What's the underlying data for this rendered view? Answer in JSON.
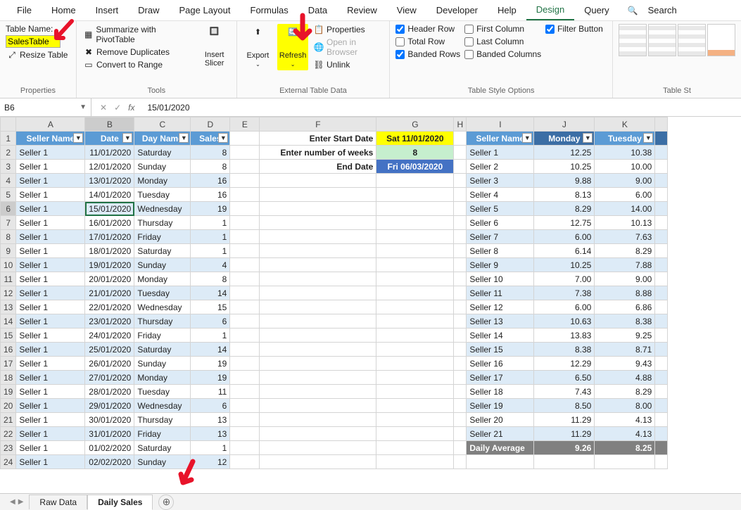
{
  "menu": {
    "items": [
      "File",
      "Home",
      "Insert",
      "Draw",
      "Page Layout",
      "Formulas",
      "Data",
      "Review",
      "View",
      "Developer",
      "Help",
      "Design",
      "Query"
    ],
    "search": "Search"
  },
  "ribbon": {
    "properties": {
      "label": "Properties",
      "table_name_label": "Table Name:",
      "table_name_value": "SalesTable",
      "resize": "Resize Table"
    },
    "tools": {
      "label": "Tools",
      "summarize": "Summarize with PivotTable",
      "remove_dupes": "Remove Duplicates",
      "convert": "Convert to Range",
      "slicer": "Insert\nSlicer"
    },
    "external": {
      "label": "External Table Data",
      "export": "Export",
      "refresh": "Refresh",
      "properties": "Properties",
      "open_browser": "Open in Browser",
      "unlink": "Unlink"
    },
    "style_opts": {
      "label": "Table Style Options",
      "header_row": "Header Row",
      "total_row": "Total Row",
      "banded_rows": "Banded Rows",
      "first_col": "First Column",
      "last_col": "Last Column",
      "banded_cols": "Banded Columns",
      "filter_btn": "Filter Button"
    },
    "table_styles": {
      "label": "Table St"
    }
  },
  "fx": {
    "namebox": "B6",
    "formula": "15/01/2020"
  },
  "cols": [
    "A",
    "B",
    "C",
    "D",
    "E",
    "F",
    "G",
    "H",
    "I",
    "J",
    "K"
  ],
  "left_headers": [
    "Seller Name",
    "Date",
    "Day Name",
    "Sales"
  ],
  "left_rows": [
    [
      "Seller 1",
      "11/01/2020",
      "Saturday",
      "8"
    ],
    [
      "Seller 1",
      "12/01/2020",
      "Sunday",
      "8"
    ],
    [
      "Seller 1",
      "13/01/2020",
      "Monday",
      "16"
    ],
    [
      "Seller 1",
      "14/01/2020",
      "Tuesday",
      "16"
    ],
    [
      "Seller 1",
      "15/01/2020",
      "Wednesday",
      "19"
    ],
    [
      "Seller 1",
      "16/01/2020",
      "Thursday",
      "1"
    ],
    [
      "Seller 1",
      "17/01/2020",
      "Friday",
      "1"
    ],
    [
      "Seller 1",
      "18/01/2020",
      "Saturday",
      "1"
    ],
    [
      "Seller 1",
      "19/01/2020",
      "Sunday",
      "4"
    ],
    [
      "Seller 1",
      "20/01/2020",
      "Monday",
      "8"
    ],
    [
      "Seller 1",
      "21/01/2020",
      "Tuesday",
      "14"
    ],
    [
      "Seller 1",
      "22/01/2020",
      "Wednesday",
      "15"
    ],
    [
      "Seller 1",
      "23/01/2020",
      "Thursday",
      "6"
    ],
    [
      "Seller 1",
      "24/01/2020",
      "Friday",
      "1"
    ],
    [
      "Seller 1",
      "25/01/2020",
      "Saturday",
      "14"
    ],
    [
      "Seller 1",
      "26/01/2020",
      "Sunday",
      "19"
    ],
    [
      "Seller 1",
      "27/01/2020",
      "Monday",
      "19"
    ],
    [
      "Seller 1",
      "28/01/2020",
      "Tuesday",
      "11"
    ],
    [
      "Seller 1",
      "29/01/2020",
      "Wednesday",
      "6"
    ],
    [
      "Seller 1",
      "30/01/2020",
      "Thursday",
      "13"
    ],
    [
      "Seller 1",
      "31/01/2020",
      "Friday",
      "13"
    ],
    [
      "Seller 1",
      "01/02/2020",
      "Saturday",
      "1"
    ],
    [
      "Seller 1",
      "02/02/2020",
      "Sunday",
      "12"
    ]
  ],
  "params": {
    "start_label": "Enter Start Date",
    "start_value": "Sat 11/01/2020",
    "weeks_label": "Enter number of weeks",
    "weeks_value": "8",
    "end_label": "End Date",
    "end_value": "Fri 06/03/2020"
  },
  "right_headers": [
    "Seller Name",
    "Monday",
    "Tuesday"
  ],
  "right_rows": [
    [
      "Seller 1",
      "12.25",
      "10.38"
    ],
    [
      "Seller 2",
      "10.25",
      "10.00"
    ],
    [
      "Seller 3",
      "9.88",
      "9.00"
    ],
    [
      "Seller 4",
      "8.13",
      "6.00"
    ],
    [
      "Seller 5",
      "8.29",
      "14.00"
    ],
    [
      "Seller 6",
      "12.75",
      "10.13"
    ],
    [
      "Seller 7",
      "6.00",
      "7.63"
    ],
    [
      "Seller 8",
      "6.14",
      "8.29"
    ],
    [
      "Seller 9",
      "10.25",
      "7.88"
    ],
    [
      "Seller 10",
      "7.00",
      "9.00"
    ],
    [
      "Seller 11",
      "7.38",
      "8.88"
    ],
    [
      "Seller 12",
      "6.00",
      "6.86"
    ],
    [
      "Seller 13",
      "10.63",
      "8.38"
    ],
    [
      "Seller 14",
      "13.83",
      "9.25"
    ],
    [
      "Seller 15",
      "8.38",
      "8.71"
    ],
    [
      "Seller 16",
      "12.29",
      "9.43"
    ],
    [
      "Seller 17",
      "6.50",
      "4.88"
    ],
    [
      "Seller 18",
      "7.43",
      "8.29"
    ],
    [
      "Seller 19",
      "8.50",
      "8.00"
    ],
    [
      "Seller 20",
      "11.29",
      "4.13"
    ],
    [
      "Seller 21",
      "11.29",
      "4.13"
    ]
  ],
  "right_avg": [
    "Daily Average",
    "9.26",
    "8.25"
  ],
  "sheets": {
    "tabs": [
      "Raw Data",
      "Daily Sales"
    ],
    "active": 1
  }
}
